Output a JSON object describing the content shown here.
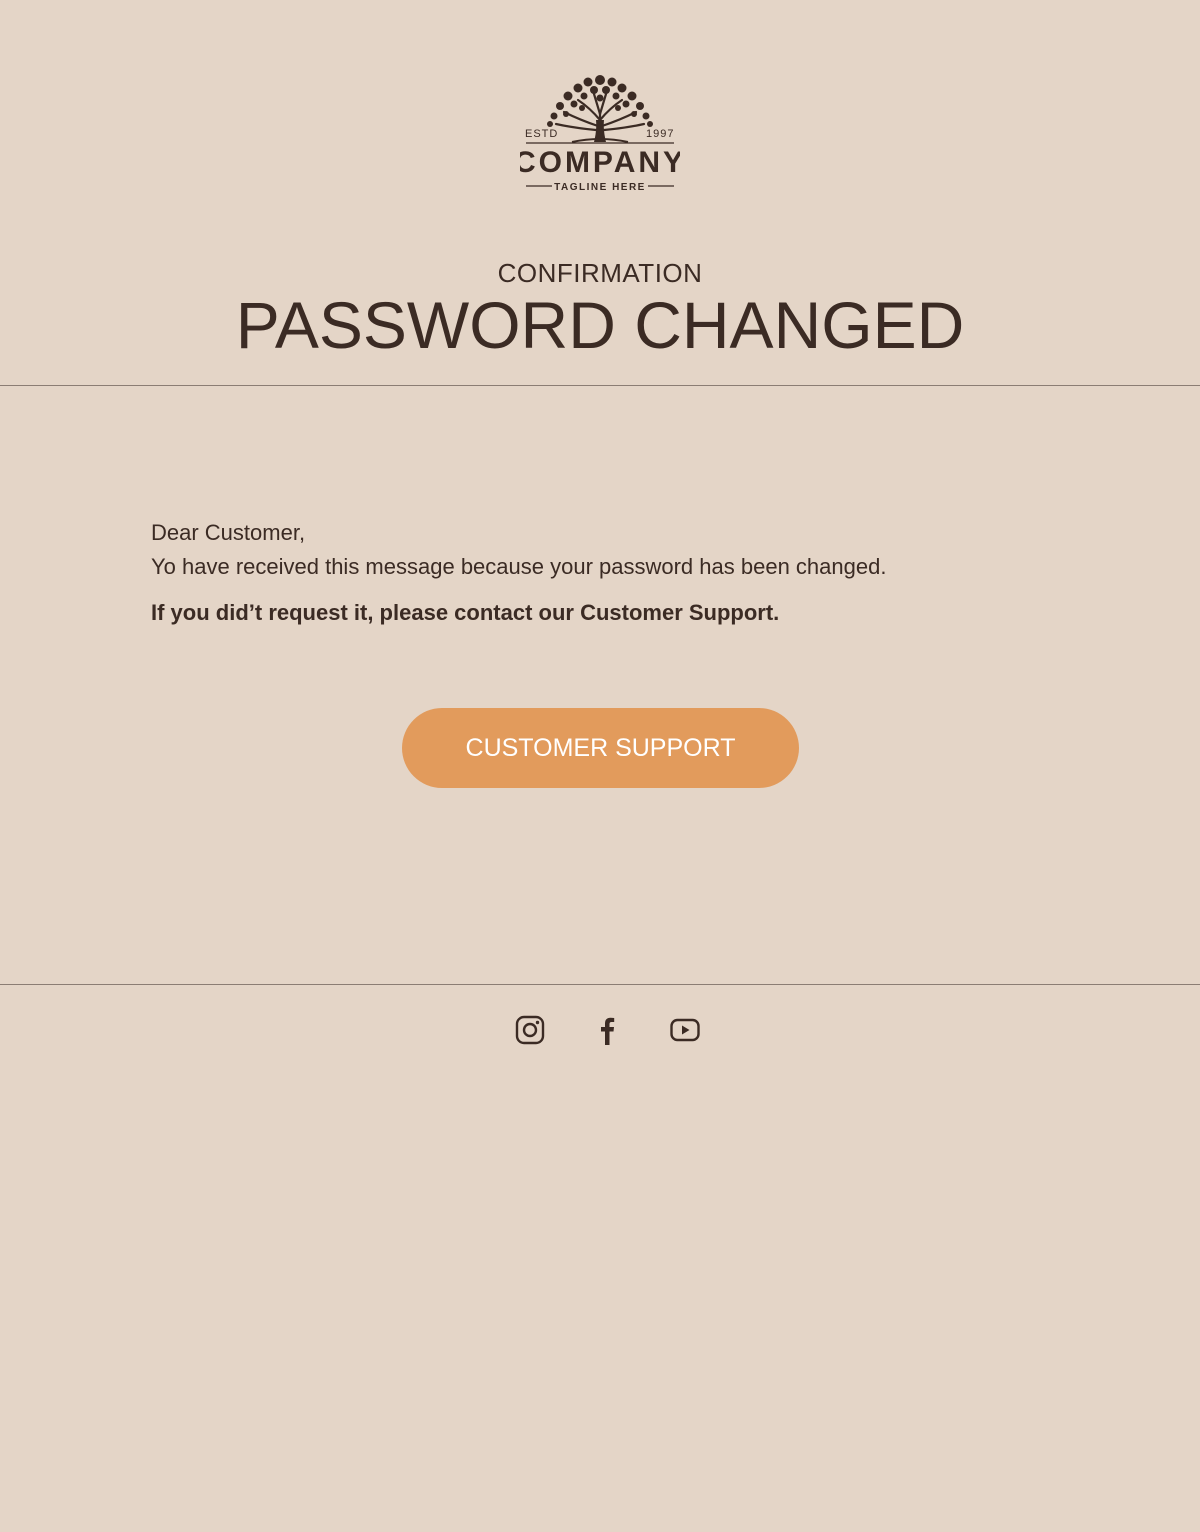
{
  "brand": {
    "estd_label": "ESTD",
    "year": "1997",
    "name": "COMPANY",
    "tagline": "TAGLINE HERE"
  },
  "header": {
    "eyebrow": "CONFIRMATION",
    "title": "PASSWORD CHANGED"
  },
  "message": {
    "greeting": "Dear Customer,",
    "body": "Yo have received this message because your password has been changed.",
    "warning": "If you did’t request it, please contact our Customer Support."
  },
  "cta": {
    "label": "CUSTOMER SUPPORT"
  },
  "social": {
    "icons": [
      "instagram-icon",
      "facebook-icon",
      "youtube-icon"
    ]
  },
  "colors": {
    "background": "#e4d5c7",
    "text": "#3b2b24",
    "accent": "#e29b5c",
    "divider": "#8b7d74"
  }
}
